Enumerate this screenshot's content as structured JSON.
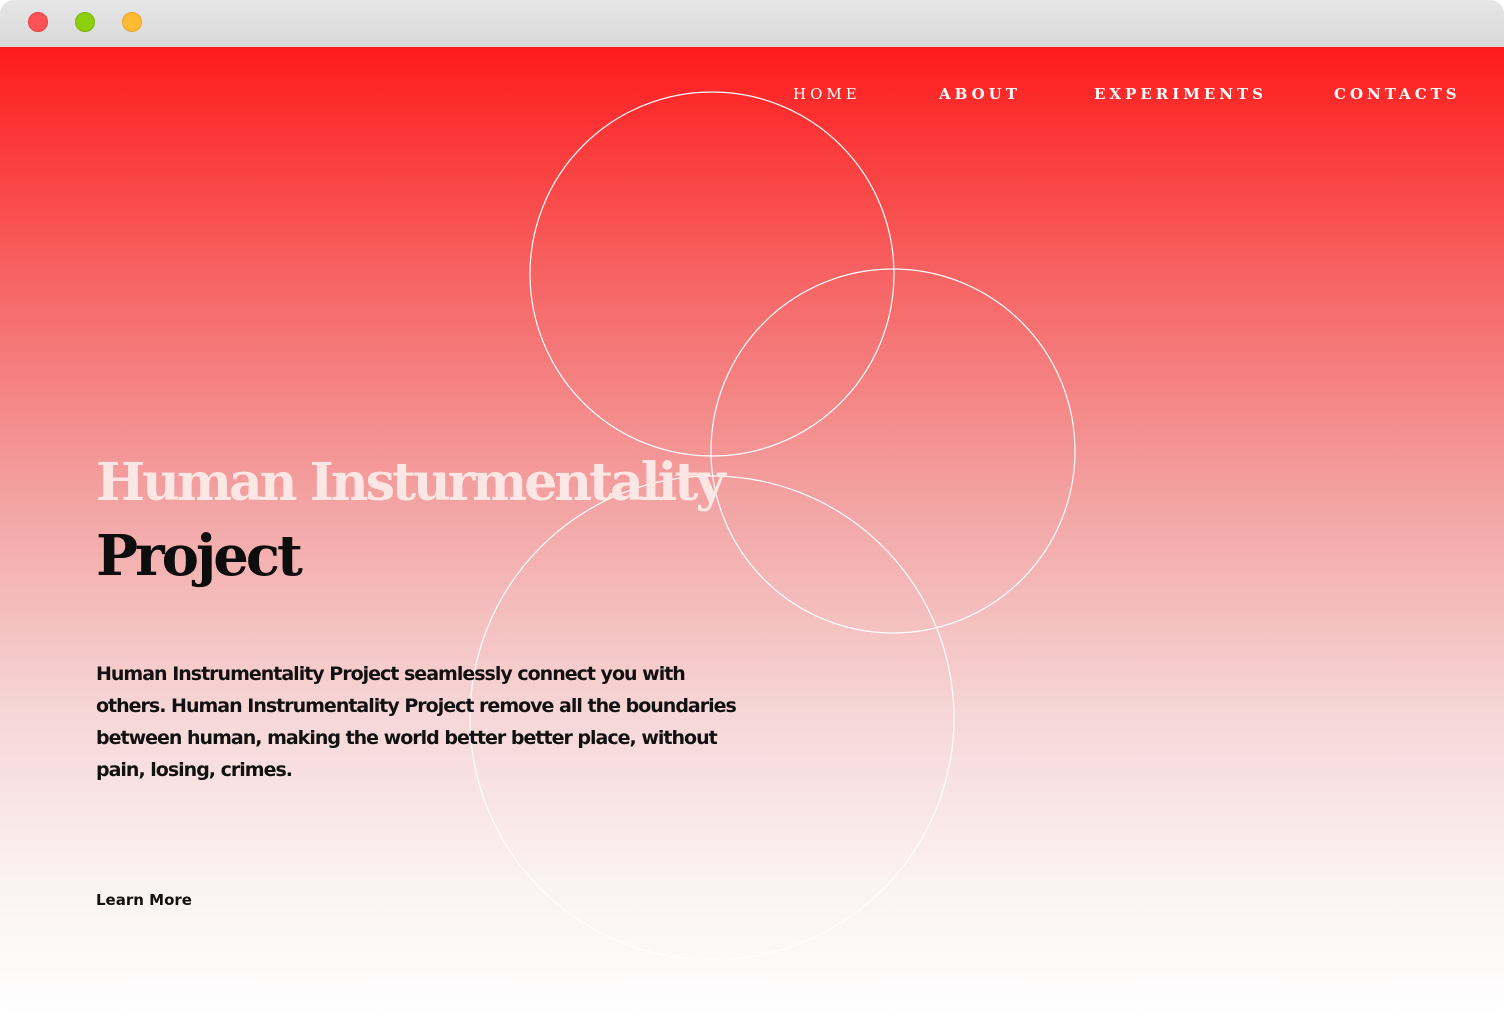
{
  "nav": {
    "items": [
      {
        "label": "HOME"
      },
      {
        "label": "ABOUT"
      },
      {
        "label": "EXPERIMENTS"
      },
      {
        "label": "CONTACTS"
      }
    ]
  },
  "hero": {
    "title_line1": "Human Insturmentality",
    "title_line2": "Project",
    "description": "Human Instrumentality Project seamlessly connect you with others. Human Instrumentality Project remove all the boundaries between human, making the world better better place, without pain, losing, crimes.",
    "cta_label": "Learn More"
  },
  "colors": {
    "gradient_top": "#ff1b1b",
    "gradient_bottom": "#ffffff",
    "title_light": "#fde7e5",
    "title_dark": "#0d0d0d",
    "circle_stroke": "#ffffff"
  }
}
